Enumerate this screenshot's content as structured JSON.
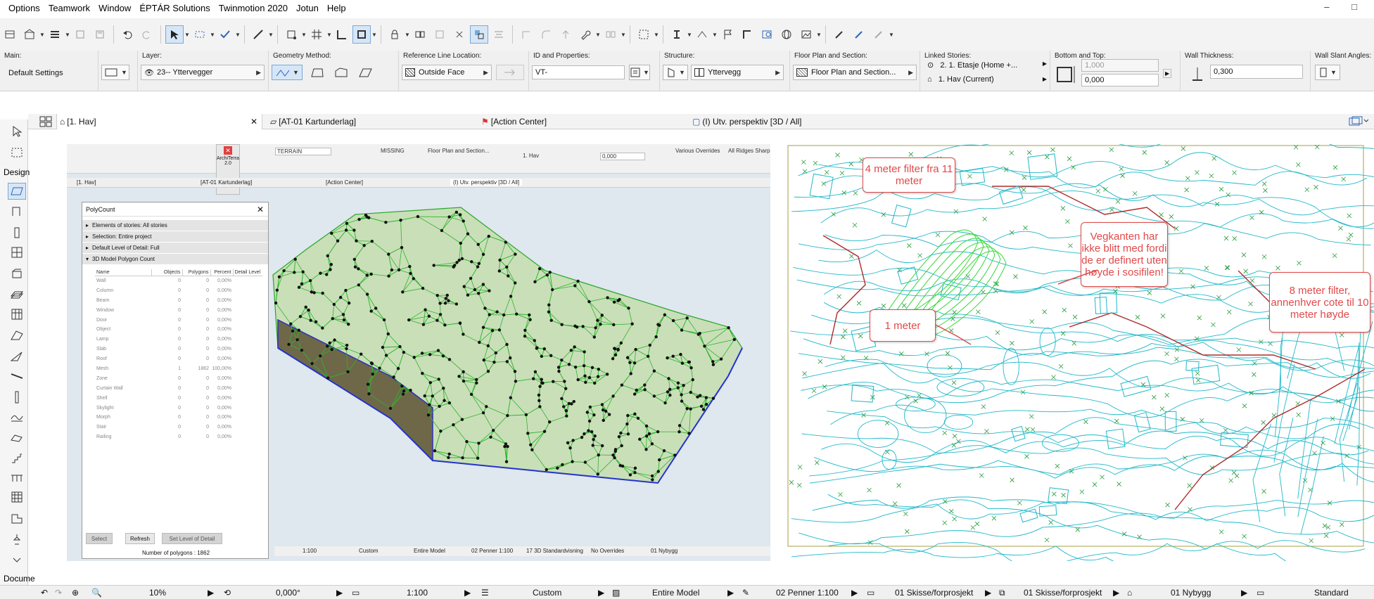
{
  "menu": [
    "Options",
    "Teamwork",
    "Window",
    "ÉPTÁR Solutions",
    "Twinmotion 2020",
    "Jotun",
    "Help"
  ],
  "window_controls": "– □",
  "infobox": {
    "main": {
      "label": "Main:",
      "value": "Default Settings"
    },
    "layer": {
      "label": "Layer:",
      "value": "23-- Yttervegger"
    },
    "geometry": {
      "label": "Geometry Method:"
    },
    "refline": {
      "label": "Reference Line Location:",
      "value": "Outside Face"
    },
    "id": {
      "label": "ID and Properties:",
      "value": "VT-"
    },
    "structure": {
      "label": "Structure:",
      "value": "Yttervegg"
    },
    "floorplan": {
      "label": "Floor Plan and Section:",
      "value": "Floor Plan and Section..."
    },
    "linked": {
      "label": "Linked Stories:",
      "top": "2. 1. Etasje (Home +...",
      "bottom": "1. Hav (Current)"
    },
    "bottomtop": {
      "label": "Bottom and Top:",
      "top_value": "1,000",
      "bottom_value": "0,000"
    },
    "thickness": {
      "label": "Wall Thickness:",
      "value": "0,300"
    },
    "slant": {
      "label": "Wall Slant Angles:"
    }
  },
  "tabs": [
    {
      "label": "[1. Hav]"
    },
    {
      "label": "[AT-01 Kartunderlag]"
    },
    {
      "label": "[Action Center]"
    },
    {
      "label": "(I) Utv. perspektiv [3D / All]"
    }
  ],
  "toolbox": {
    "design_label": "Design",
    "docu_label": "Docume"
  },
  "embedded": {
    "infobox_items": [
      "TERRAIN",
      "MISSING",
      "Floor Plan and Section...",
      "1. Hav",
      "0,000",
      "Various Overrides",
      "All Ridges Sharp"
    ],
    "tabs": [
      "[1. Hav]",
      "[AT-01 Kartunderlag]",
      "[Action Center]",
      "(I) Utv. perspektiv [3D / All]"
    ],
    "archi_title": "ArchiTerra 2.0",
    "status": [
      "1:100",
      "Custom",
      "Entire Model",
      "02 Penner 1:100",
      "17 3D Standardvisning",
      "No Overrides",
      "01 Nybygg"
    ]
  },
  "polycount": {
    "title": "PolyCount",
    "sections": [
      "Elements of stories: All stories",
      "Selection: Entire project",
      "Default Level of Detail: Full",
      "3D Model Polygon Count"
    ],
    "columns": [
      "Name",
      "Objects",
      "Polygons",
      "Percent",
      "Detail Level"
    ],
    "rows": [
      {
        "name": "Wall",
        "objects": "0",
        "polygons": "0",
        "percent": "0,00%"
      },
      {
        "name": "Column",
        "objects": "0",
        "polygons": "0",
        "percent": "0,00%"
      },
      {
        "name": "Beam",
        "objects": "0",
        "polygons": "0",
        "percent": "0,00%"
      },
      {
        "name": "Window",
        "objects": "0",
        "polygons": "0",
        "percent": "0,00%"
      },
      {
        "name": "Door",
        "objects": "0",
        "polygons": "0",
        "percent": "0,00%"
      },
      {
        "name": "Object",
        "objects": "0",
        "polygons": "0",
        "percent": "0,00%"
      },
      {
        "name": "Lamp",
        "objects": "0",
        "polygons": "0",
        "percent": "0,00%"
      },
      {
        "name": "Slab",
        "objects": "0",
        "polygons": "0",
        "percent": "0,00%"
      },
      {
        "name": "Roof",
        "objects": "0",
        "polygons": "0",
        "percent": "0,00%"
      },
      {
        "name": "Mesh",
        "objects": "1",
        "polygons": "1862",
        "percent": "100,00%"
      },
      {
        "name": "Zone",
        "objects": "0",
        "polygons": "0",
        "percent": "0,00%"
      },
      {
        "name": "Curtain Wall",
        "objects": "0",
        "polygons": "0",
        "percent": "0,00%"
      },
      {
        "name": "Shell",
        "objects": "0",
        "polygons": "0",
        "percent": "0,00%"
      },
      {
        "name": "Skylight",
        "objects": "0",
        "polygons": "0",
        "percent": "0,00%"
      },
      {
        "name": "Morph",
        "objects": "0",
        "polygons": "0",
        "percent": "0,00%"
      },
      {
        "name": "Stair",
        "objects": "0",
        "polygons": "0",
        "percent": "0,00%"
      },
      {
        "name": "Railing",
        "objects": "0",
        "polygons": "0",
        "percent": "0,00%"
      }
    ],
    "buttons": {
      "select": "Select",
      "refresh": "Refresh",
      "set_level": "Set Level of Detail"
    },
    "footer": "Number of polygons : 1862"
  },
  "callouts": {
    "c1": "4 meter filter fra 11 meter",
    "c2": "Vegkanten har ikke blitt med fordi de er definert uten høyde i sosifilen!",
    "c3": "1 meter",
    "c4": "8 meter filter, annenhver cote til 10 meter høyde"
  },
  "statusbar": {
    "zoom": "10%",
    "angle": "0,000°",
    "scale": "1:100",
    "structure": "Custom",
    "model": "Entire Model",
    "pens": "02 Penner 1:100",
    "mvo": "01 Skisse/forprosjekt",
    "layer_combo": "01 Skisse/forprosjekt",
    "renovation": "01 Nybygg",
    "dimension": "Standard"
  },
  "colors": {
    "accent": "#7aa9d8",
    "mesh_green": "#29b52c",
    "contour_cyan": "#1fb8c8",
    "road_red": "#b02a2a",
    "callout_red": "#e04a4a"
  }
}
